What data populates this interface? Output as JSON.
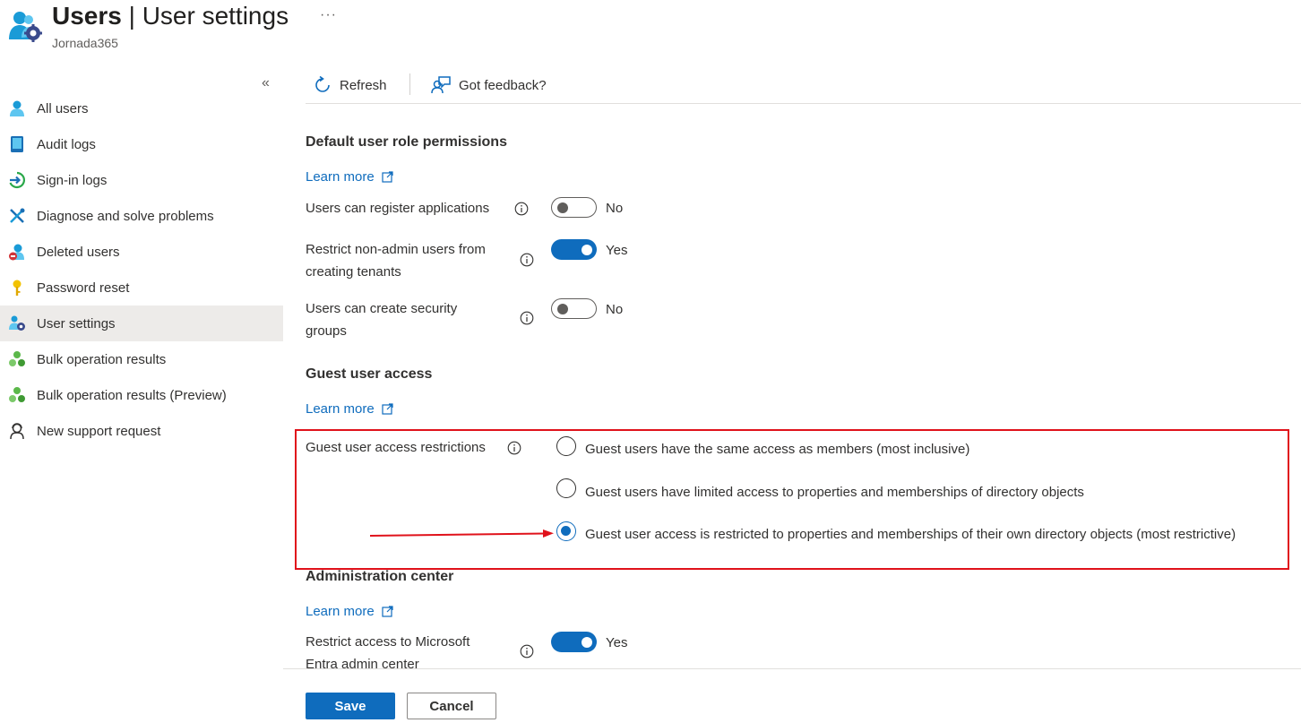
{
  "header": {
    "title_main": "Users",
    "title_sep": " | ",
    "title_page": "User settings",
    "more": "···",
    "subtitle": "Jornada365",
    "icon": "users-gear-icon"
  },
  "sidebar": {
    "collapse": "«",
    "items": [
      {
        "label": "All users",
        "icon": "user-icon"
      },
      {
        "label": "Audit logs",
        "icon": "audit-log-icon"
      },
      {
        "label": "Sign-in logs",
        "icon": "sign-in-icon"
      },
      {
        "label": "Diagnose and solve problems",
        "icon": "wrench-icon"
      },
      {
        "label": "Deleted users",
        "icon": "deleted-user-icon"
      },
      {
        "label": "Password reset",
        "icon": "key-icon"
      },
      {
        "label": "User settings",
        "icon": "user-settings-icon",
        "active": true
      },
      {
        "label": "Bulk operation results",
        "icon": "bulk-icon"
      },
      {
        "label": "Bulk operation results (Preview)",
        "icon": "bulk-preview-icon"
      },
      {
        "label": "New support request",
        "icon": "support-icon"
      }
    ]
  },
  "toolbar": {
    "refresh": "Refresh",
    "feedback": "Got feedback?"
  },
  "sections": {
    "default_role": {
      "title": "Default user role permissions",
      "learn_more": "Learn more",
      "settings": [
        {
          "label_line1": "Users can register applications",
          "label_line2": "",
          "value": "No",
          "on": false
        },
        {
          "label_line1": "Restrict non-admin users from",
          "label_line2": "creating tenants",
          "value": "Yes",
          "on": true
        },
        {
          "label_line1": "Users can create security",
          "label_line2": "groups",
          "value": "No",
          "on": false
        }
      ]
    },
    "guest_access": {
      "title": "Guest user access",
      "learn_more": "Learn more",
      "restrictions_label": "Guest user access restrictions",
      "options": [
        {
          "label": "Guest users have the same access as members (most inclusive)",
          "checked": false
        },
        {
          "label": "Guest users have limited access to properties and memberships of directory objects",
          "checked": false
        },
        {
          "label": "Guest user access is restricted to properties and memberships of their own directory objects (most restrictive)",
          "checked": true
        }
      ]
    },
    "admin_center": {
      "title": "Administration center",
      "learn_more": "Learn more",
      "setting": {
        "label_line1": "Restrict access to Microsoft",
        "label_line2": "Entra admin center",
        "value": "Yes",
        "on": true
      }
    }
  },
  "footer": {
    "save": "Save",
    "cancel": "Cancel"
  },
  "colors": {
    "accent": "#0f6cbd",
    "highlight": "#e0121b",
    "active_nav_bg": "#edebe9"
  }
}
